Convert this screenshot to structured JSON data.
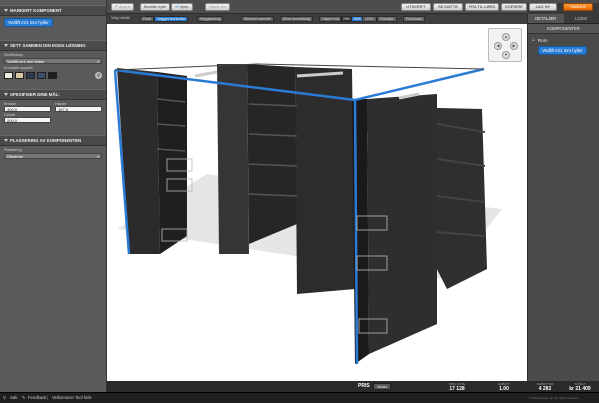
{
  "left": {
    "section1_title": "MARKERT KOMPONENT",
    "selected_btn": "Vedlift m/1 mm hyller",
    "section2_title": "SETT SAMMEN DIN EGEN LØSNING",
    "system_label": "Skuffeskap",
    "system_value": "Vedlift m/1 mm hyller",
    "color_label": "Kompakt oppsett",
    "section3_title": "SPESIFISER DINE MÅL:",
    "width_label": "Bredde",
    "width_value": "300,0",
    "height_label": "Høyde",
    "height_value": "157,8",
    "depth_label": "Dybde",
    "depth_value": "200,0",
    "section4_title": "PLASSERING AV KOMPONENTEN",
    "placement_label": "Plassering",
    "placement_value": "Gjestrom",
    "swatch_colors": [
      "#f0ece2",
      "#d9c8a6",
      "#2c3a52",
      "#3e4f6a",
      "#1e1e1e"
    ]
  },
  "topbar": {
    "btn_undo": "Angre",
    "btn_redo": "Gjøre om",
    "btn_new": "Bestille hylle",
    "btn_help": "Hjelp",
    "right_btns": [
      "UTSKRIFT",
      "SE DØTTE",
      "FRA TIL LØRD",
      "KOPIERE",
      "LAG NY"
    ],
    "orange_btn": "HANDLE"
  },
  "tabs": {
    "view_label": "Velg utsnitt",
    "items": [
      "Rom",
      "Vegger bortenfor",
      "Veggvisning",
      "Skrevet rommet",
      "Øvre innredning",
      "Høyre innredning"
    ],
    "zoom": [
      "20%",
      "50%",
      "100%"
    ],
    "extra": [
      "Forstørr",
      "Forminsk"
    ]
  },
  "right": {
    "tab_details": "DETALJER",
    "tab_logo": "LOGO",
    "heading": "KOMPONENTER",
    "item": "Rom",
    "sub_btn": "Vedlift m/1 mm hyller"
  },
  "bottom": {
    "pris_label": "PRIS",
    "pris_btn": "tilbake",
    "cols": [
      {
        "label": "PRIS LISTE",
        "value": "17 128"
      },
      {
        "label": "RABATT",
        "value": "1.00"
      },
      {
        "label": "RABATT KR",
        "value": "4 282"
      },
      {
        "label": "TOTALT",
        "value": "kr 21 409"
      }
    ]
  },
  "status": {
    "search": "Søk",
    "feedback": "Feedback",
    "welcome": "Velkommen Tool hele",
    "copyright": "© 2013 Google Inc. All rights reserved."
  }
}
